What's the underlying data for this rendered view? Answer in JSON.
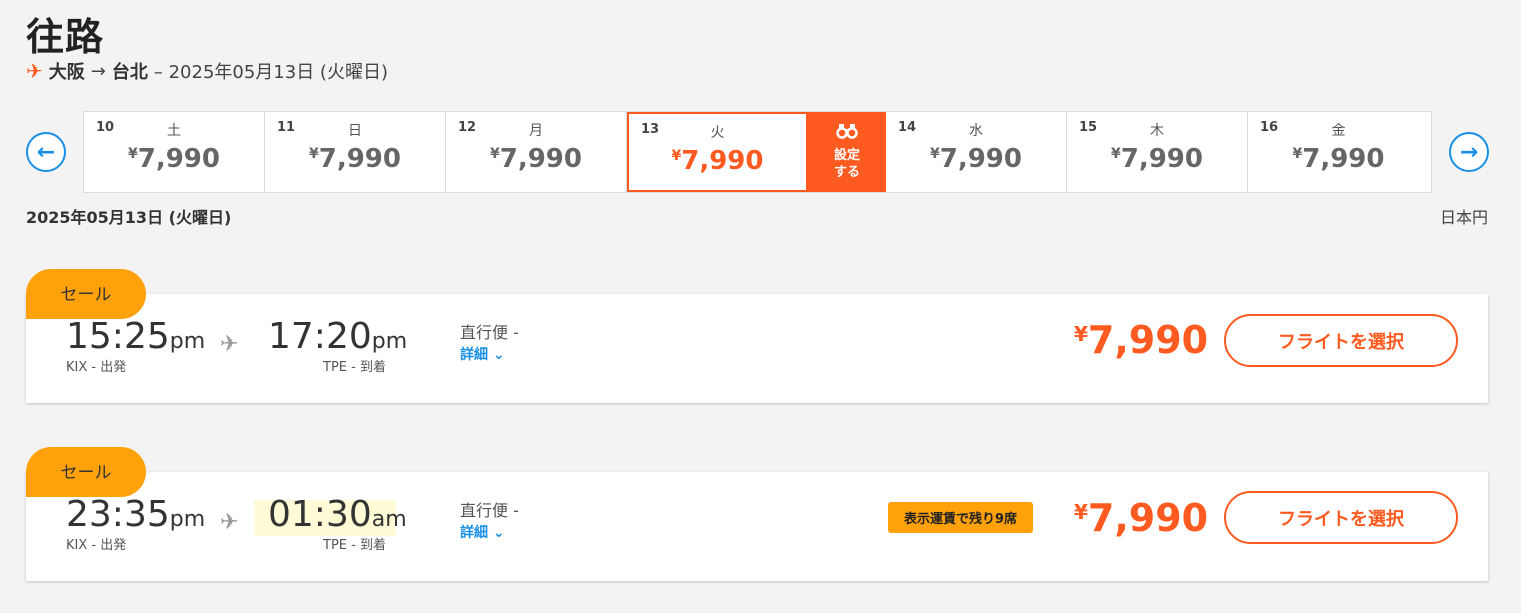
{
  "header": {
    "title": "往路",
    "route_from": "大阪",
    "route_arrow": "→",
    "route_to": "台北",
    "route_date": "– 2025年05月13日 (火曜日)"
  },
  "date_strip": {
    "days": [
      {
        "num": "10",
        "dow": "土",
        "currency": "¥",
        "price": "7,990"
      },
      {
        "num": "11",
        "dow": "日",
        "currency": "¥",
        "price": "7,990"
      },
      {
        "num": "12",
        "dow": "月",
        "currency": "¥",
        "price": "7,990"
      },
      {
        "num": "13",
        "dow": "火",
        "currency": "¥",
        "price": "7,990"
      },
      {
        "num": "14",
        "dow": "水",
        "currency": "¥",
        "price": "7,990"
      },
      {
        "num": "15",
        "dow": "木",
        "currency": "¥",
        "price": "7,990"
      },
      {
        "num": "16",
        "dow": "金",
        "currency": "¥",
        "price": "7,990"
      }
    ],
    "settings_line1": "設定",
    "settings_line2": "する"
  },
  "selected_date": "2025年05月13日 (火曜日)",
  "currency_label": "日本円",
  "flights": [
    {
      "badge": "セール",
      "dep_time": "15:25",
      "dep_ampm": "pm",
      "dep_label": "KIX - 出発",
      "arr_time": "17:20",
      "arr_ampm": "pm",
      "arr_label": "TPE - 到着",
      "type": "直行便 -",
      "details": "詳細",
      "seats_left": "",
      "currency": "¥",
      "price": "7,990",
      "select_label": "フライトを選択"
    },
    {
      "badge": "セール",
      "dep_time": "23:35",
      "dep_ampm": "pm",
      "dep_label": "KIX - 出発",
      "arr_time": "01:30",
      "arr_ampm": "am",
      "arr_label": "TPE - 到着",
      "type": "直行便 -",
      "details": "詳細",
      "seats_left": "表示運賃で残り9席",
      "currency": "¥",
      "price": "7,990",
      "select_label": "フライトを選択"
    }
  ],
  "colors": {
    "accent": "#ff5a1f",
    "sale": "#ffa10a",
    "link": "#1a8fe6"
  },
  "icons": {
    "route": "plane-icon",
    "prev": "arrow-left-circle-icon",
    "next": "arrow-right-circle-icon",
    "settings": "binoculars-icon",
    "details": "chevron-down-icon"
  }
}
